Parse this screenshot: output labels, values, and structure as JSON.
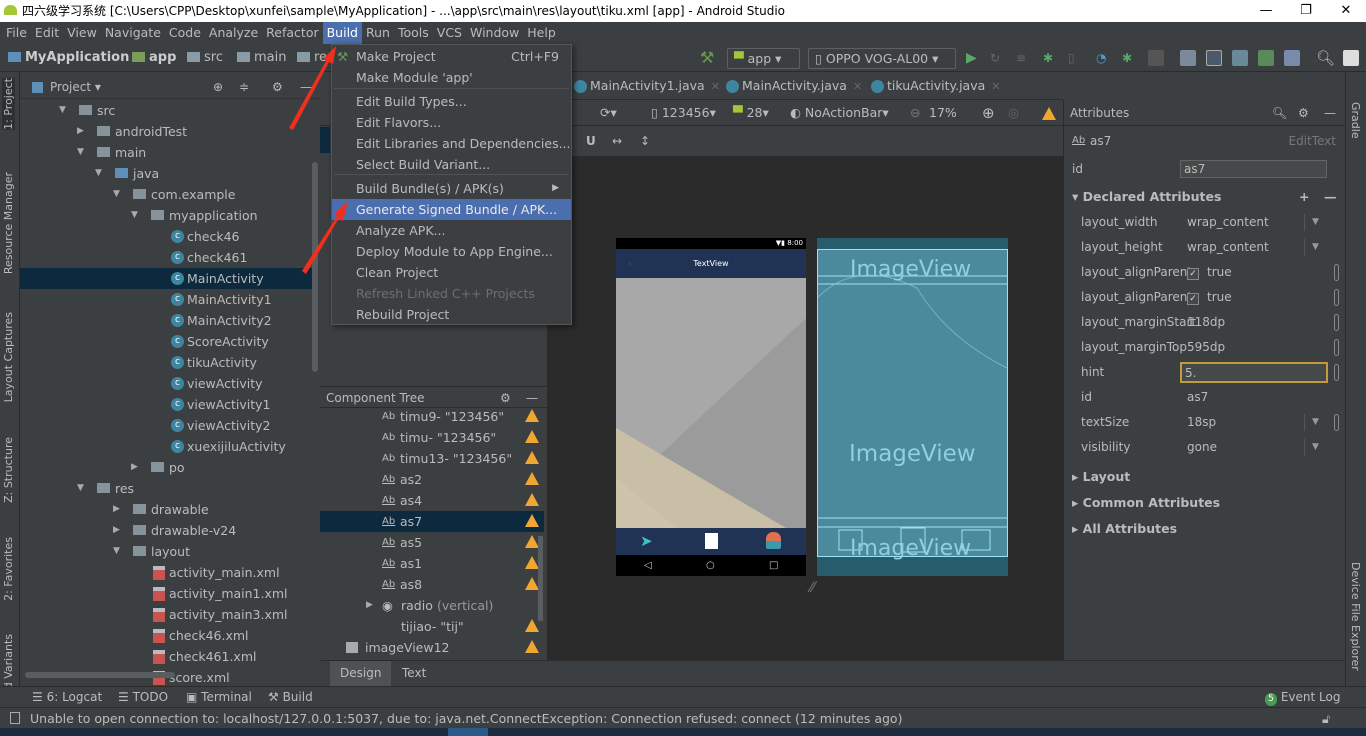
{
  "window": {
    "title": "四六级学习系统 [C:\\Users\\CPP\\Desktop\\xunfei\\sample\\MyApplication] - ...\\app\\src\\main\\res\\layout\\tiku.xml [app] - Android Studio",
    "controls": [
      "—",
      "❐",
      "✕"
    ]
  },
  "menubar": [
    "File",
    "Edit",
    "View",
    "Navigate",
    "Code",
    "Analyze",
    "Refactor",
    "Build",
    "Run",
    "Tools",
    "VCS",
    "Window",
    "Help"
  ],
  "menubar_active": "Build",
  "breadcrumb": [
    "MyApplication",
    "app",
    "src",
    "main",
    "re"
  ],
  "toolbar": {
    "config": "app",
    "device": "OPPO VOG-AL00"
  },
  "build_menu": [
    {
      "label": "Make Project",
      "shortcut": "Ctrl+F9"
    },
    {
      "label": "Make Module 'app'"
    },
    {
      "label": "Edit Build Types..."
    },
    {
      "label": "Edit Flavors..."
    },
    {
      "label": "Edit Libraries and Dependencies..."
    },
    {
      "label": "Select Build Variant..."
    },
    {
      "label": "Build Bundle(s) / APK(s)",
      "submenu": true
    },
    {
      "label": "Generate Signed Bundle / APK...",
      "highlighted": true
    },
    {
      "label": "Analyze APK..."
    },
    {
      "label": "Deploy Module to App Engine..."
    },
    {
      "label": "Clean Project"
    },
    {
      "label": "Refresh Linked C++ Projects",
      "disabled": true
    },
    {
      "label": "Rebuild Project"
    }
  ],
  "left_strip": [
    "1: Project",
    "Resource Manager",
    "Layout Captures",
    "Z: Structure",
    "2: Favorites",
    "d Variants"
  ],
  "right_strip": [
    "Gradle",
    "Device File Explorer"
  ],
  "project": {
    "title": "Project",
    "tree": [
      {
        "label": "src",
        "indent": 0,
        "type": "folder",
        "expanded": true
      },
      {
        "label": "androidTest",
        "indent": 1,
        "type": "folder",
        "expanded": false
      },
      {
        "label": "main",
        "indent": 1,
        "type": "folder",
        "expanded": true
      },
      {
        "label": "java",
        "indent": 2,
        "type": "folder",
        "expanded": true
      },
      {
        "label": "com.example",
        "indent": 3,
        "type": "folder",
        "expanded": true
      },
      {
        "label": "myapplication",
        "indent": 4,
        "type": "folder",
        "expanded": true
      },
      {
        "label": "check46",
        "indent": 5,
        "type": "class"
      },
      {
        "label": "check461",
        "indent": 5,
        "type": "class"
      },
      {
        "label": "MainActivity",
        "indent": 5,
        "type": "class",
        "selected": true
      },
      {
        "label": "MainActivity1",
        "indent": 5,
        "type": "class"
      },
      {
        "label": "MainActivity2",
        "indent": 5,
        "type": "class"
      },
      {
        "label": "ScoreActivity",
        "indent": 5,
        "type": "class"
      },
      {
        "label": "tikuActivity",
        "indent": 5,
        "type": "class"
      },
      {
        "label": "viewActivity",
        "indent": 5,
        "type": "class"
      },
      {
        "label": "viewActivity1",
        "indent": 5,
        "type": "class"
      },
      {
        "label": "viewActivity2",
        "indent": 5,
        "type": "class"
      },
      {
        "label": "xuexijiluActivity",
        "indent": 5,
        "type": "class"
      },
      {
        "label": "po",
        "indent": 4,
        "type": "folder",
        "expanded": false
      },
      {
        "label": "res",
        "indent": 1,
        "type": "folder",
        "expanded": true
      },
      {
        "label": "drawable",
        "indent": 3,
        "type": "folder",
        "expanded": false
      },
      {
        "label": "drawable-v24",
        "indent": 3,
        "type": "folder",
        "expanded": false
      },
      {
        "label": "layout",
        "indent": 3,
        "type": "folder",
        "expanded": true
      },
      {
        "label": "activity_main.xml",
        "indent": 4,
        "type": "xml"
      },
      {
        "label": "activity_main1.xml",
        "indent": 4,
        "type": "xml"
      },
      {
        "label": "activity_main3.xml",
        "indent": 4,
        "type": "xml"
      },
      {
        "label": "check46.xml",
        "indent": 4,
        "type": "xml"
      },
      {
        "label": "check461.xml",
        "indent": 4,
        "type": "xml"
      },
      {
        "label": "score.xml",
        "indent": 4,
        "type": "xml"
      }
    ]
  },
  "editor_tabs": [
    "MainActivity1.java",
    "MainActivity.java",
    "tikuActivity.java"
  ],
  "design_toolbar": {
    "device": "123456",
    "api": "28",
    "theme": "NoActionBar",
    "zoom": "17%"
  },
  "component_tree": {
    "title": "Component Tree",
    "items": [
      {
        "label": "timu9- \"123456\"",
        "warn": true
      },
      {
        "label": "timu- \"123456\"",
        "warn": true
      },
      {
        "label": "timu13- \"123456\"",
        "warn": true
      },
      {
        "label": "as2",
        "warn": true
      },
      {
        "label": "as4",
        "warn": true
      },
      {
        "label": "as7",
        "warn": true,
        "selected": true
      },
      {
        "label": "as5",
        "warn": true
      },
      {
        "label": "as1",
        "warn": true
      },
      {
        "label": "as8",
        "warn": true
      },
      {
        "label": "radio",
        "suffix": "(vertical)",
        "warn": false
      },
      {
        "label": "tijiao- \"tij\"",
        "warn": true
      },
      {
        "label": "imageView12",
        "warn": true
      }
    ]
  },
  "phone_preview": {
    "status_time": "8:00",
    "title": "TextView"
  },
  "blueprint": {
    "labels": [
      "ImageView",
      "ImageView",
      "ImageView"
    ]
  },
  "attributes": {
    "title": "Attributes",
    "component": "as7",
    "component_type": "EditText",
    "id_label": "id",
    "id_value": "as7",
    "declared_title": "Declared Attributes",
    "declared": [
      {
        "key": "layout_width",
        "value": "wrap_content",
        "dropdown": true
      },
      {
        "key": "layout_height",
        "value": "wrap_content",
        "dropdown": true
      },
      {
        "key": "layout_alignParent",
        "value": "true",
        "checkbox": true
      },
      {
        "key": "layout_alignParent",
        "value": "true",
        "checkbox": true
      },
      {
        "key": "layout_marginStart",
        "value": "118dp"
      },
      {
        "key": "layout_marginTop",
        "value": "595dp"
      },
      {
        "key": "hint",
        "value": "5.",
        "editing": true
      },
      {
        "key": "id",
        "value": "as7"
      },
      {
        "key": "textSize",
        "value": "18sp",
        "dropdown": true
      },
      {
        "key": "visibility",
        "value": "gone",
        "dropdown": true
      }
    ],
    "sections": [
      "Layout",
      "Common Attributes",
      "All Attributes"
    ]
  },
  "design_tabs": [
    "Design",
    "Text"
  ],
  "tool_windows": [
    "6: Logcat",
    "TODO",
    "Terminal",
    "Build"
  ],
  "event_log": {
    "label": "Event Log",
    "count": "5"
  },
  "status": "Unable to open connection to: localhost/127.0.0.1:5037, due to: java.net.ConnectException: Connection refused: connect (12 minutes ago)",
  "colors": {
    "accent": "#4b6eaf",
    "selection": "#0d293e",
    "warning": "#f0a732",
    "annotation_arrow": "#f0301e"
  }
}
